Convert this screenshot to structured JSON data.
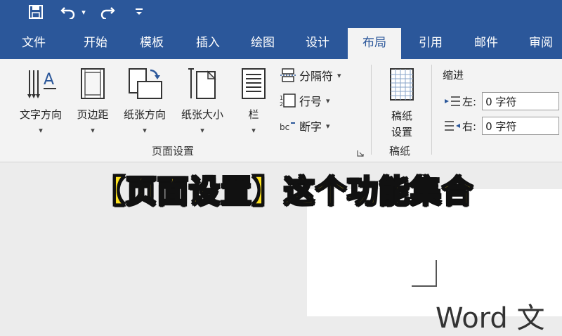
{
  "quick_access": {
    "save_icon": "save-icon",
    "undo_icon": "undo-icon",
    "redo_icon": "redo-icon",
    "customize_icon": "customize-qat-icon"
  },
  "tabs": [
    {
      "label": "文件",
      "active": false
    },
    {
      "label": "开始",
      "active": false
    },
    {
      "label": "模板",
      "active": false
    },
    {
      "label": "插入",
      "active": false
    },
    {
      "label": "绘图",
      "active": false
    },
    {
      "label": "设计",
      "active": false
    },
    {
      "label": "布局",
      "active": true
    },
    {
      "label": "引用",
      "active": false
    },
    {
      "label": "邮件",
      "active": false
    },
    {
      "label": "审阅",
      "active": false
    }
  ],
  "page_setup": {
    "text_direction": "文字方向",
    "margins": "页边距",
    "orientation": "纸张方向",
    "size": "纸张大小",
    "columns": "栏",
    "breaks": "分隔符",
    "line_numbers": "行号",
    "hyphenation": "断字",
    "group_label": "页面设置"
  },
  "manuscript": {
    "button": "稿纸\n设置",
    "button_line1": "稿纸",
    "button_line2": "设置",
    "group_label": "稿纸"
  },
  "paragraph": {
    "indent_title": "缩进",
    "left_label": "左:",
    "left_value": "0 字符",
    "right_label": "右:",
    "right_value": "0 字符"
  },
  "overlay_caption": "【页面设置】这个功能集合",
  "document_text": "Word 文",
  "colors": {
    "ribbon_blue": "#2b579a",
    "caption_yellow": "#fde11e"
  }
}
